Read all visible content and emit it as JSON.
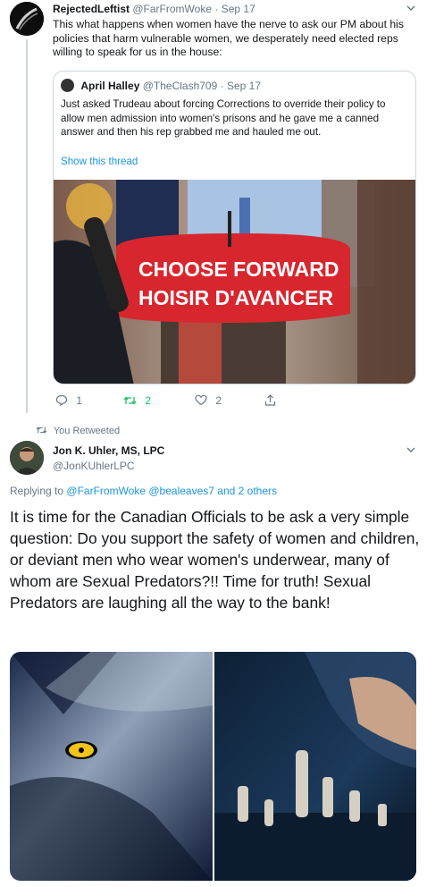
{
  "tweet1": {
    "display_name": "RejectedLeftist",
    "handle": "@FarFromWoke",
    "separator": "·",
    "date": "Sep 17",
    "text": "This what happens when women have the nerve to ask our PM about his policies that harm vulnerable women, we desperately need elected reps willing to speak for us in the house:"
  },
  "quote": {
    "display_name": "April Halley",
    "handle": "@TheClash709",
    "separator": "·",
    "date": "Sep 17",
    "text": "Just asked Trudeau about forcing Corrections to override their policy to allow men admission into women's prisons and he gave me a canned answer and then his rep grabbed me and hauled me out.",
    "show_thread": "Show this thread",
    "sign_line1": "CHOOSE FORWARD",
    "sign_line2": "HOISIR D'AVANCER"
  },
  "actions": {
    "replies": "1",
    "retweets": "2",
    "likes": "2"
  },
  "retweet_label": "You Retweeted",
  "tweet2": {
    "display_name": "Jon K. Uhler, MS, LPC",
    "handle": "@JonKUhlerLPC",
    "replying_prefix": "Replying to",
    "replying_users": "@FarFromWoke @bealeaves7",
    "replying_suffix": "and 2 others",
    "text": "It is time for the Canadian Officials to be ask a very simple question: Do you support the safety of women and children, or deviant men who wear women's underwear, many of whom are Sexual Predators?!! Time for truth! Sexual Predators are laughing all the way to the bank!"
  },
  "colors": {
    "link": "#1b95e0",
    "muted": "#657786",
    "retweet_green": "#17bf63",
    "sign_red": "#d8262e",
    "border": "#ccd6dd"
  }
}
